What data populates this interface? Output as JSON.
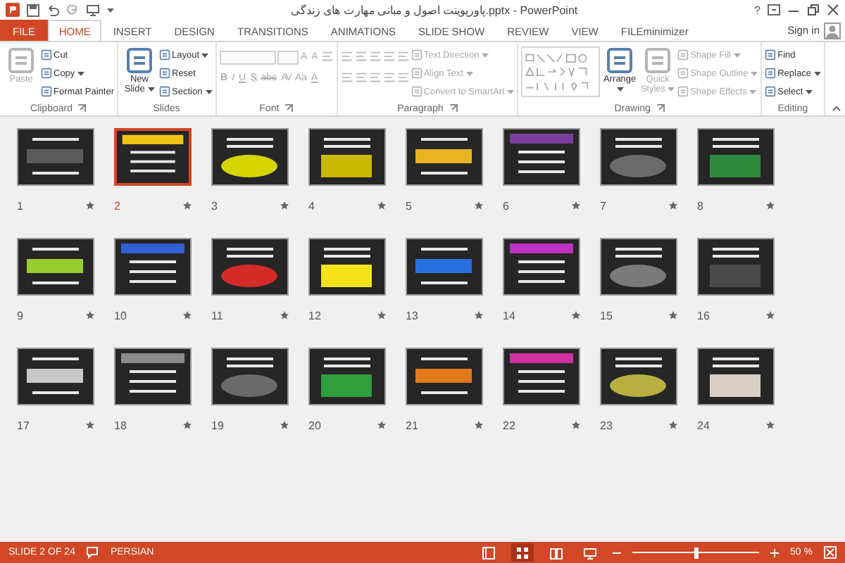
{
  "title_bar": {
    "title": "پاورپوینت اصول و مبانی مهارت های زندگی.pptx - PowerPoint",
    "help": "?"
  },
  "tabs": [
    {
      "label": "FILE",
      "kind": "file",
      "selected": false
    },
    {
      "label": "HOME",
      "kind": "tab",
      "selected": true
    },
    {
      "label": "INSERT",
      "kind": "tab",
      "selected": false
    },
    {
      "label": "DESIGN",
      "kind": "tab",
      "selected": false
    },
    {
      "label": "TRANSITIONS",
      "kind": "tab",
      "selected": false
    },
    {
      "label": "ANIMATIONS",
      "kind": "tab",
      "selected": false
    },
    {
      "label": "SLIDE SHOW",
      "kind": "tab",
      "selected": false
    },
    {
      "label": "REVIEW",
      "kind": "tab",
      "selected": false
    },
    {
      "label": "VIEW",
      "kind": "tab",
      "selected": false
    },
    {
      "label": "FILEminimizer",
      "kind": "tab",
      "selected": false
    }
  ],
  "account": {
    "label": "Sign in"
  },
  "ribbon": {
    "groups": [
      {
        "label": "Clipboard",
        "launcher": true,
        "columns": [
          {
            "kind": "large",
            "items": [
              {
                "label": "Paste",
                "disabled": true,
                "dropdown": false
              }
            ]
          },
          {
            "kind": "stack",
            "items": [
              {
                "label": "Cut",
                "disabled": false,
                "dropdown": false
              },
              {
                "label": "Copy",
                "disabled": false,
                "dropdown": true
              },
              {
                "label": "Format Painter",
                "disabled": false,
                "dropdown": false
              }
            ]
          }
        ]
      },
      {
        "label": "Slides",
        "launcher": false,
        "columns": [
          {
            "kind": "large",
            "items": [
              {
                "label": "New Slide",
                "disabled": false,
                "dropdown": true
              }
            ]
          },
          {
            "kind": "stack",
            "items": [
              {
                "label": "Layout",
                "disabled": false,
                "dropdown": true
              },
              {
                "label": "Reset",
                "disabled": false,
                "dropdown": false
              },
              {
                "label": "Section",
                "disabled": false,
                "dropdown": true
              }
            ]
          }
        ]
      },
      {
        "label": "Font",
        "launcher": true,
        "columns": [
          {
            "kind": "lines",
            "lines": [
              [
                {
                  "kind": "font-field",
                  "disabled": true
                },
                {
                  "kind": "size-field",
                  "disabled": true
                },
                {
                  "kind": "glyph",
                  "label": "A",
                  "disabled": true
                },
                {
                  "kind": "glyph",
                  "label": "A",
                  "disabled": true
                },
                {
                  "kind": "icon",
                  "disabled": true
                }
              ],
              [
                {
                  "kind": "glyph",
                  "label": "B",
                  "disabled": true
                },
                {
                  "kind": "glyph",
                  "label": "I",
                  "disabled": true
                },
                {
                  "kind": "glyph",
                  "label": "U",
                  "disabled": true
                },
                {
                  "kind": "glyph",
                  "label": "S",
                  "disabled": true
                },
                {
                  "kind": "glyph",
                  "label": "abc",
                  "disabled": true
                },
                {
                  "kind": "glyph",
                  "label": "AV",
                  "disabled": true
                },
                {
                  "kind": "glyph",
                  "label": "Aa",
                  "disabled": true
                },
                {
                  "kind": "glyph",
                  "label": "A",
                  "disabled": true
                }
              ]
            ]
          }
        ]
      },
      {
        "label": "Paragraph",
        "launcher": true,
        "columns": [
          {
            "kind": "lines",
            "lines": [
              [
                {
                  "kind": "icon",
                  "disabled": true
                },
                {
                  "kind": "icon",
                  "disabled": true
                },
                {
                  "kind": "icon",
                  "disabled": true
                },
                {
                  "kind": "icon",
                  "disabled": true
                },
                {
                  "kind": "icon",
                  "disabled": true
                }
              ],
              [
                {
                  "kind": "icon",
                  "disabled": true
                },
                {
                  "kind": "icon",
                  "disabled": true
                },
                {
                  "kind": "icon",
                  "disabled": true
                },
                {
                  "kind": "icon",
                  "disabled": true
                },
                {
                  "kind": "icon",
                  "disabled": true
                }
              ]
            ]
          },
          {
            "kind": "stack",
            "items": [
              {
                "label": "Text Direction",
                "disabled": true,
                "dropdown": true
              },
              {
                "label": "Align Text",
                "disabled": true,
                "dropdown": true
              },
              {
                "label": "Convert to SmartArt",
                "disabled": true,
                "dropdown": true
              }
            ]
          }
        ]
      },
      {
        "label": "Drawing",
        "launcher": true,
        "columns": [
          {
            "kind": "gallery",
            "disabled": true
          },
          {
            "kind": "large",
            "items": [
              {
                "label": "Arrange",
                "disabled": false,
                "dropdown": true
              }
            ]
          },
          {
            "kind": "large",
            "items": [
              {
                "label": "Quick Styles",
                "disabled": true,
                "dropdown": true
              }
            ]
          },
          {
            "kind": "stack",
            "items": [
              {
                "label": "Shape Fill",
                "disabled": true,
                "dropdown": true
              },
              {
                "label": "Shape Outline",
                "disabled": true,
                "dropdown": true
              },
              {
                "label": "Shape Effects",
                "disabled": true,
                "dropdown": true
              }
            ]
          }
        ]
      },
      {
        "label": "Editing",
        "launcher": false,
        "columns": [
          {
            "kind": "stack",
            "items": [
              {
                "label": "Find",
                "disabled": false,
                "dropdown": false
              },
              {
                "label": "Replace",
                "disabled": false,
                "dropdown": true
              },
              {
                "label": "Select",
                "disabled": false,
                "dropdown": true
              }
            ]
          }
        ]
      }
    ]
  },
  "slides": [
    {
      "number": "1",
      "selected": false,
      "color": "#5a5a5a"
    },
    {
      "number": "2",
      "selected": true,
      "color": "#f0c419"
    },
    {
      "number": "3",
      "selected": false,
      "color": "#d4d400"
    },
    {
      "number": "4",
      "selected": false,
      "color": "#c9b800"
    },
    {
      "number": "5",
      "selected": false,
      "color": "#e6b422"
    },
    {
      "number": "6",
      "selected": false,
      "color": "#7a3d9e"
    },
    {
      "number": "7",
      "selected": false,
      "color": "#6b6b6b"
    },
    {
      "number": "8",
      "selected": false,
      "color": "#2e8b3e"
    },
    {
      "number": "9",
      "selected": false,
      "color": "#9acd32"
    },
    {
      "number": "10",
      "selected": false,
      "color": "#2f5fd0"
    },
    {
      "number": "11",
      "selected": false,
      "color": "#d42a2a"
    },
    {
      "number": "12",
      "selected": false,
      "color": "#f5e31a"
    },
    {
      "number": "13",
      "selected": false,
      "color": "#2a6fe0"
    },
    {
      "number": "14",
      "selected": false,
      "color": "#c030c0"
    },
    {
      "number": "15",
      "selected": false,
      "color": "#7a7a7a"
    },
    {
      "number": "16",
      "selected": false,
      "color": "#4a4a4a"
    },
    {
      "number": "17",
      "selected": false,
      "color": "#c8c8c8"
    },
    {
      "number": "18",
      "selected": false,
      "color": "#8a8a8a"
    },
    {
      "number": "19",
      "selected": false,
      "color": "#6a6a6a"
    },
    {
      "number": "20",
      "selected": false,
      "color": "#2e9e3e"
    },
    {
      "number": "21",
      "selected": false,
      "color": "#e07a1a"
    },
    {
      "number": "22",
      "selected": false,
      "color": "#d030a0"
    },
    {
      "number": "23",
      "selected": false,
      "color": "#b8b040"
    },
    {
      "number": "24",
      "selected": false,
      "color": "#d8cfc4"
    }
  ],
  "status_bar": {
    "slide_info": "SLIDE 2 OF 24",
    "language": "PERSIAN",
    "views": [
      {
        "kind": "normal",
        "selected": false
      },
      {
        "kind": "sorter",
        "selected": true
      },
      {
        "kind": "reading",
        "selected": false
      },
      {
        "kind": "slideshow",
        "selected": false
      }
    ],
    "zoom": {
      "level": 0.5,
      "reading": "50 %"
    }
  }
}
